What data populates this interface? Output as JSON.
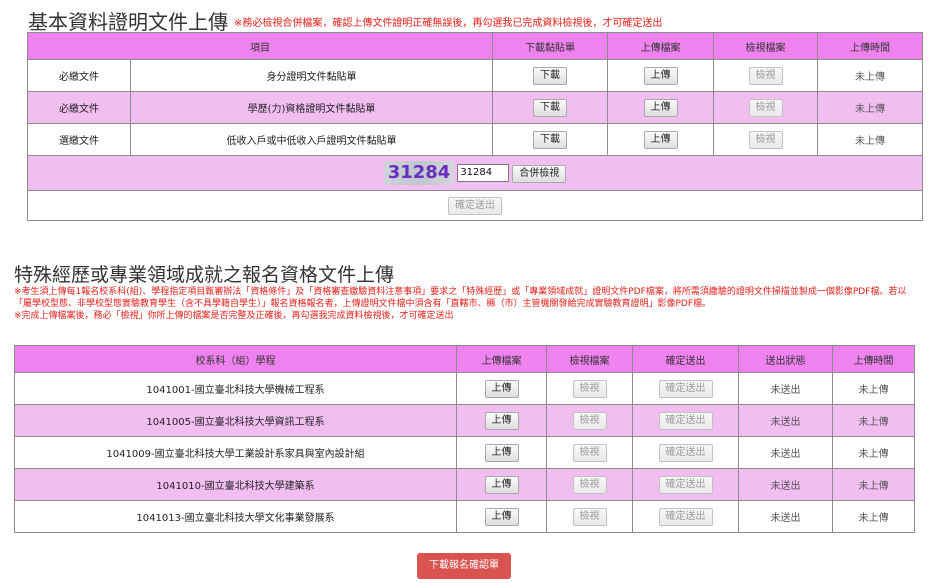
{
  "section1": {
    "title": "基本資料證明文件上傳",
    "warning": "※務必檢視合併檔案，確認上傳文件證明正確無誤後，再勾選我已完成資料檢視後，才可確定送出",
    "headers": {
      "item": "項目",
      "download": "下載黏貼單",
      "upload": "上傳檔案",
      "view": "檢視檔案",
      "time": "上傳時間"
    },
    "rows": [
      {
        "type": "必繳文件",
        "name": "身分證明文件黏貼單",
        "download": "下載",
        "upload": "上傳",
        "view": "檢視",
        "time": "未上傳"
      },
      {
        "type": "必繳文件",
        "name": "學歷(力)資格證明文件黏貼單",
        "download": "下載",
        "upload": "上傳",
        "view": "檢視",
        "time": "未上傳"
      },
      {
        "type": "選繳文件",
        "name": "低收入戶或中低收入戶證明文件黏貼單",
        "download": "下載",
        "upload": "上傳",
        "view": "檢視",
        "time": "未上傳"
      }
    ],
    "captcha_code": "31284",
    "captcha_input_value": "31284",
    "merge_view_button": "合併檢視",
    "confirm_button": "確定送出"
  },
  "section2": {
    "title": "特殊經歷或專業領域成就之報名資格文件上傳",
    "note1": "※考生須上傳每1報名校系科(組)、學程指定項目甄審辦法「資格條件」及「資格審查繳驗資料注意事項」要求之「特殊經歷」或「專業領域成就」證明文件PDF檔案，將所需須繳驗的證明文件掃描並製成一個影像PDF檔。若以「屬學校型態、非學校型態實驗教育學生（含不具學籍自學生）」報名資格報名者，上傳證明文件檔中須含有「直轄市、縣（市）主管機關發給完成實驗教育證明」影像PDF檔。",
    "note2": "※完成上傳檔案後，務必「檢視」你所上傳的檔案是否完整及正確後，再勾選我完成資料檢視後，才可確定送出",
    "headers": {
      "dept": "校系科（組）學程",
      "upload": "上傳檔案",
      "view": "檢視檔案",
      "confirm": "確定送出",
      "status": "送出狀態",
      "time": "上傳時間"
    },
    "rows": [
      {
        "dept": "1041001-國立臺北科技大學機械工程系",
        "upload": "上傳",
        "view": "檢視",
        "confirm": "確定送出",
        "status": "未送出",
        "time": "未上傳"
      },
      {
        "dept": "1041005-國立臺北科技大學資訊工程系",
        "upload": "上傳",
        "view": "檢視",
        "confirm": "確定送出",
        "status": "未送出",
        "time": "未上傳"
      },
      {
        "dept": "1041009-國立臺北科技大學工業設計系家具與室內設計組",
        "upload": "上傳",
        "view": "檢視",
        "confirm": "確定送出",
        "status": "未送出",
        "time": "未上傳"
      },
      {
        "dept": "1041010-國立臺北科技大學建築系",
        "upload": "上傳",
        "view": "檢視",
        "confirm": "確定送出",
        "status": "未送出",
        "time": "未上傳"
      },
      {
        "dept": "1041013-國立臺北科技大學文化事業發展系",
        "upload": "上傳",
        "view": "檢視",
        "confirm": "確定送出",
        "status": "未送出",
        "time": "未上傳"
      }
    ]
  },
  "download_confirm_button": "下載報名確認單",
  "colors": {
    "header_pink": "#ee82ee",
    "row_pink": "#f2bef2",
    "warning_red": "#e8201a",
    "captcha_purple": "#6a2fbf",
    "download_red": "#d9534f"
  }
}
